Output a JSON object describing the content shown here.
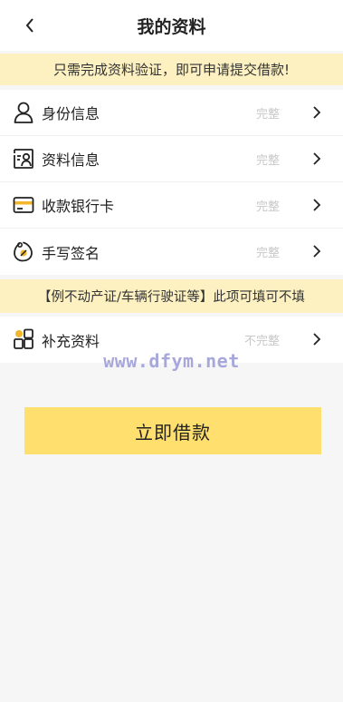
{
  "header": {
    "title": "我的资料"
  },
  "notice_top": "只需完成资料验证，即可申请提交借款!",
  "items": [
    {
      "label": "身份信息",
      "status": "完整",
      "icon": "person-icon"
    },
    {
      "label": "资料信息",
      "status": "完整",
      "icon": "profile-card-icon"
    },
    {
      "label": "收款银行卡",
      "status": "完整",
      "icon": "bank-card-icon"
    },
    {
      "label": "手写签名",
      "status": "完整",
      "icon": "signature-icon"
    }
  ],
  "notice_extra": "【例不动产证/车辆行驶证等】此项可填可不填",
  "extra_item": {
    "label": "补充资料",
    "status": "不完整",
    "icon": "blocks-icon"
  },
  "watermark": "www.dfym.net",
  "submit_button": "立即借款",
  "colors": {
    "accent": "#ffdf6e",
    "notice_bg": "#fdf1c2",
    "status": "#c8c8c8"
  }
}
